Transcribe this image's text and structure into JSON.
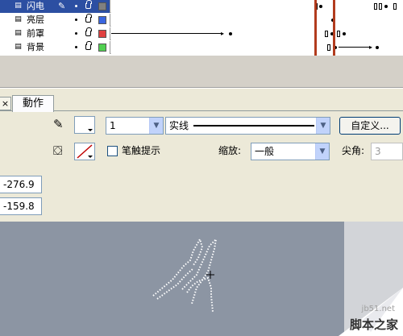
{
  "timeline": {
    "layers": [
      {
        "name": "闪电",
        "selected": true,
        "color": "#808080",
        "icon": "layer-icon"
      },
      {
        "name": "亮层",
        "selected": false,
        "color": "#3a66e0",
        "icon": "layer-icon"
      },
      {
        "name": "前罩",
        "selected": false,
        "color": "#e04040",
        "icon": "layer-icon"
      },
      {
        "name": "背景",
        "selected": false,
        "color": "#50d050",
        "icon": "layer-icon"
      }
    ],
    "playhead_color": "#b23c1e"
  },
  "panel": {
    "tab_close": "×",
    "tab_label": "動作",
    "stroke_width_value": "1",
    "stroke_style_value": "实线",
    "custom_button": "自定义...",
    "stroke_hint_label": "笔触提示",
    "scale_label": "缩放:",
    "scale_value": "一般",
    "miter_label": "尖角:",
    "miter_value": "3",
    "x_value": "-276.9",
    "y_value": "-159.8"
  },
  "watermark": {
    "url": "jb51.net",
    "text": "脚本之家"
  },
  "colors": {
    "stage": "#8c95a3",
    "panel": "#ece9d8",
    "selected_layer": "#2c4fa2"
  }
}
